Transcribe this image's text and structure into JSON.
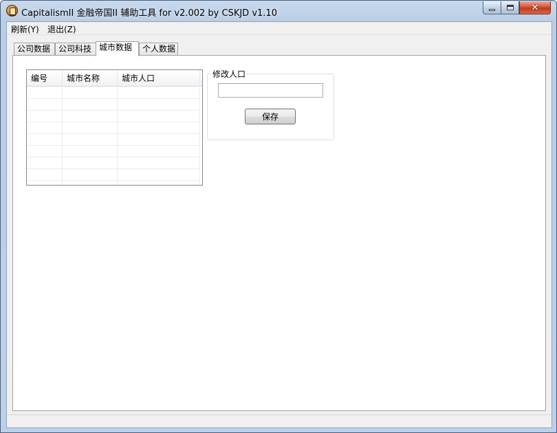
{
  "window": {
    "title": "CapitalismII 金融帝国II 辅助工具 for v2.002 by CSKJD v1.10",
    "close_glyph": "✕",
    "icon": "app-coin-icon"
  },
  "menu": {
    "refresh": "刷新(Y)",
    "exit": "退出(Z)"
  },
  "tabs": [
    {
      "label": "公司数据",
      "active": false
    },
    {
      "label": "公司科技",
      "active": false
    },
    {
      "label": "城市数据",
      "active": true
    },
    {
      "label": "个人数据",
      "active": false
    }
  ],
  "city_list": {
    "columns": [
      "编号",
      "城市名称",
      "城市人口"
    ],
    "rows": []
  },
  "edit_population": {
    "legend": "修改人口",
    "value": "",
    "save_label": "保存"
  },
  "status": {
    "text": ""
  }
}
